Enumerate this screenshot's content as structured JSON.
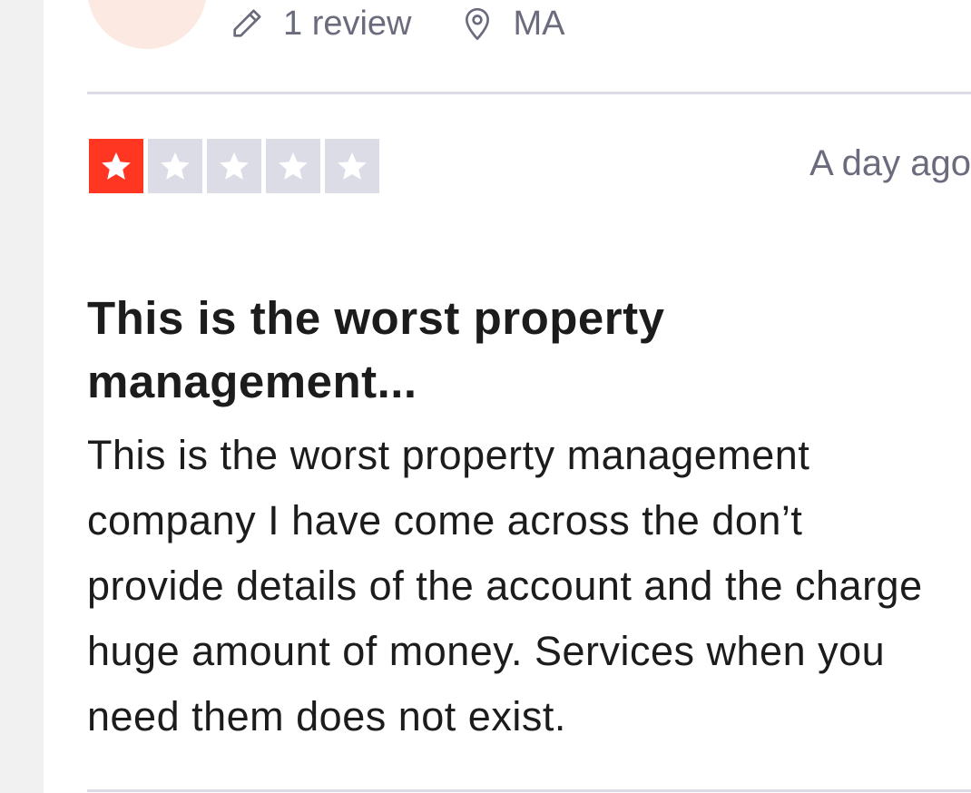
{
  "reviewer": {
    "initials": "...",
    "review_count": "1 review",
    "location": "MA"
  },
  "review": {
    "rating": 1,
    "max_rating": 5,
    "date": "A day ago",
    "title": "This is the worst property management...",
    "body": "This is the worst property management company I have come across the don’t provide details of the account and the charge huge amount of money. Services when you need them does not exist."
  },
  "icons": {
    "review_count": "pencil-icon",
    "location": "location-pin-icon",
    "star": "star-icon"
  },
  "colors": {
    "star_filled": "#ff3722",
    "star_empty": "#dcdce6",
    "muted_text": "#6b6b7e",
    "text": "#1c1c1c",
    "avatar_bg": "#fbe9e2",
    "divider": "#dcdce6"
  }
}
